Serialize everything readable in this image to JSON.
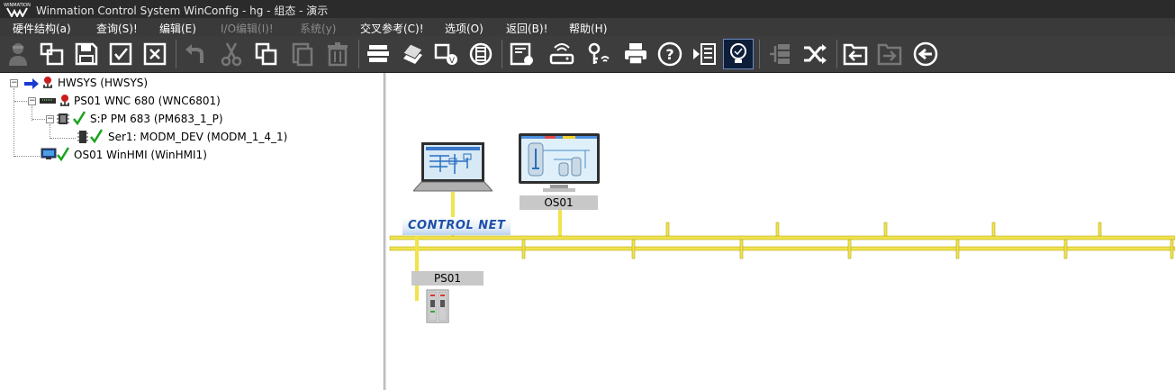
{
  "window": {
    "title": "Winmation Control System WinConfig - hg - 组态 - 演示",
    "logo_text": "WINMATION"
  },
  "menu": [
    {
      "label": "硬件结构(a)",
      "enabled": true
    },
    {
      "label": "查询(S)!",
      "enabled": true
    },
    {
      "label": "编辑(E)",
      "enabled": true
    },
    {
      "label": "I/O编辑(I)!",
      "enabled": false
    },
    {
      "label": "系统(y)",
      "enabled": false
    },
    {
      "label": "交叉参考(C)!",
      "enabled": true
    },
    {
      "label": "选项(O)",
      "enabled": true
    },
    {
      "label": "返回(B)!",
      "enabled": true
    },
    {
      "label": "帮助(H)",
      "enabled": true
    }
  ],
  "toolbar": [
    {
      "icon": "user-icon",
      "enabled": false
    },
    {
      "icon": "new-window-icon",
      "enabled": true
    },
    {
      "icon": "save-icon",
      "enabled": true
    },
    {
      "icon": "checkbox-checked-icon",
      "enabled": true
    },
    {
      "icon": "checkbox-cross-icon",
      "enabled": true
    },
    {
      "icon": "undo-icon",
      "enabled": false
    },
    {
      "icon": "cut-icon",
      "enabled": false
    },
    {
      "icon": "copy-icon",
      "enabled": true
    },
    {
      "icon": "paste-icon",
      "enabled": false
    },
    {
      "icon": "delete-icon",
      "enabled": false
    },
    {
      "icon": "stack-icon",
      "enabled": true
    },
    {
      "icon": "layers-icon",
      "enabled": true
    },
    {
      "icon": "io-icon",
      "enabled": true
    },
    {
      "icon": "connector-icon",
      "enabled": true
    },
    {
      "icon": "module-settings-icon",
      "enabled": true
    },
    {
      "icon": "wireless-router-icon",
      "enabled": true
    },
    {
      "icon": "wireless-key-icon",
      "enabled": true
    },
    {
      "icon": "printer-icon",
      "enabled": true
    },
    {
      "icon": "help-icon",
      "enabled": true
    },
    {
      "icon": "list-view-icon",
      "enabled": true
    },
    {
      "icon": "lightbulb-icon",
      "enabled": true,
      "active": true
    },
    {
      "icon": "split-icon",
      "enabled": false
    },
    {
      "icon": "shuffle-icon",
      "enabled": true
    },
    {
      "icon": "import-icon",
      "enabled": true
    },
    {
      "icon": "export-icon",
      "enabled": false
    },
    {
      "icon": "back-icon",
      "enabled": true
    }
  ],
  "tree": {
    "root": {
      "label": "HWSYS (HWSYS)",
      "expanded": true
    },
    "ps01": {
      "label": "PS01    WNC 680 (WNC6801)",
      "expanded": true
    },
    "pm": {
      "label": "S:P PM 683 (PM683_1_P)",
      "expanded": true
    },
    "ser1": {
      "label": "Ser1: MODM_DEV (MODM_1_4_1)"
    },
    "os01": {
      "label": "OS01    WinHMI (WinHMI1)"
    }
  },
  "network": {
    "bus_label": "CONTROL NET",
    "os_label": "OS01",
    "ps_label": "PS01"
  },
  "colors": {
    "titlebar": "#2b2b2b",
    "menubar": "#3a3a3a",
    "toolbar": "#3d3d3d",
    "bus_yellow": "#f0e34c",
    "check_green": "#1aa31a",
    "arrow_blue": "#1a3bd1"
  }
}
